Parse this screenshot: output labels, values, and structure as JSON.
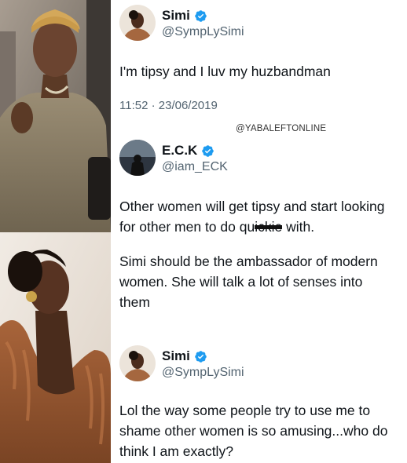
{
  "watermark": "@YABALEFTONLINE",
  "tweets": [
    {
      "display_name": "Simi",
      "handle": "@SympLySimi",
      "verified": true,
      "text_lines": [
        "I'm tipsy and I luv my huzbandman"
      ],
      "timestamp": "11:52 · 23/06/2019"
    },
    {
      "display_name": "E.C.K",
      "handle": "@iam_ECK",
      "verified": true,
      "para1_line1": "Other women will get tipsy and start looking",
      "para1_line2_before": "for other men to do qu",
      "para1_line2_redacted": "ickie",
      "para1_line2_after": " with.",
      "para2": "Simi should be the ambassador of modern women. She will talk a lot of senses into them"
    },
    {
      "display_name": "Simi",
      "handle": "@SympLySimi",
      "verified": true,
      "text": "Lol the way some people try to use me to shame other women is so amusing...who do think I am exactly?"
    }
  ],
  "colors": {
    "verified_blue": "#1d9bf0",
    "secondary_text": "#536471",
    "primary_text": "#0f1419"
  },
  "icons": {
    "verified": "verified-badge-icon"
  }
}
